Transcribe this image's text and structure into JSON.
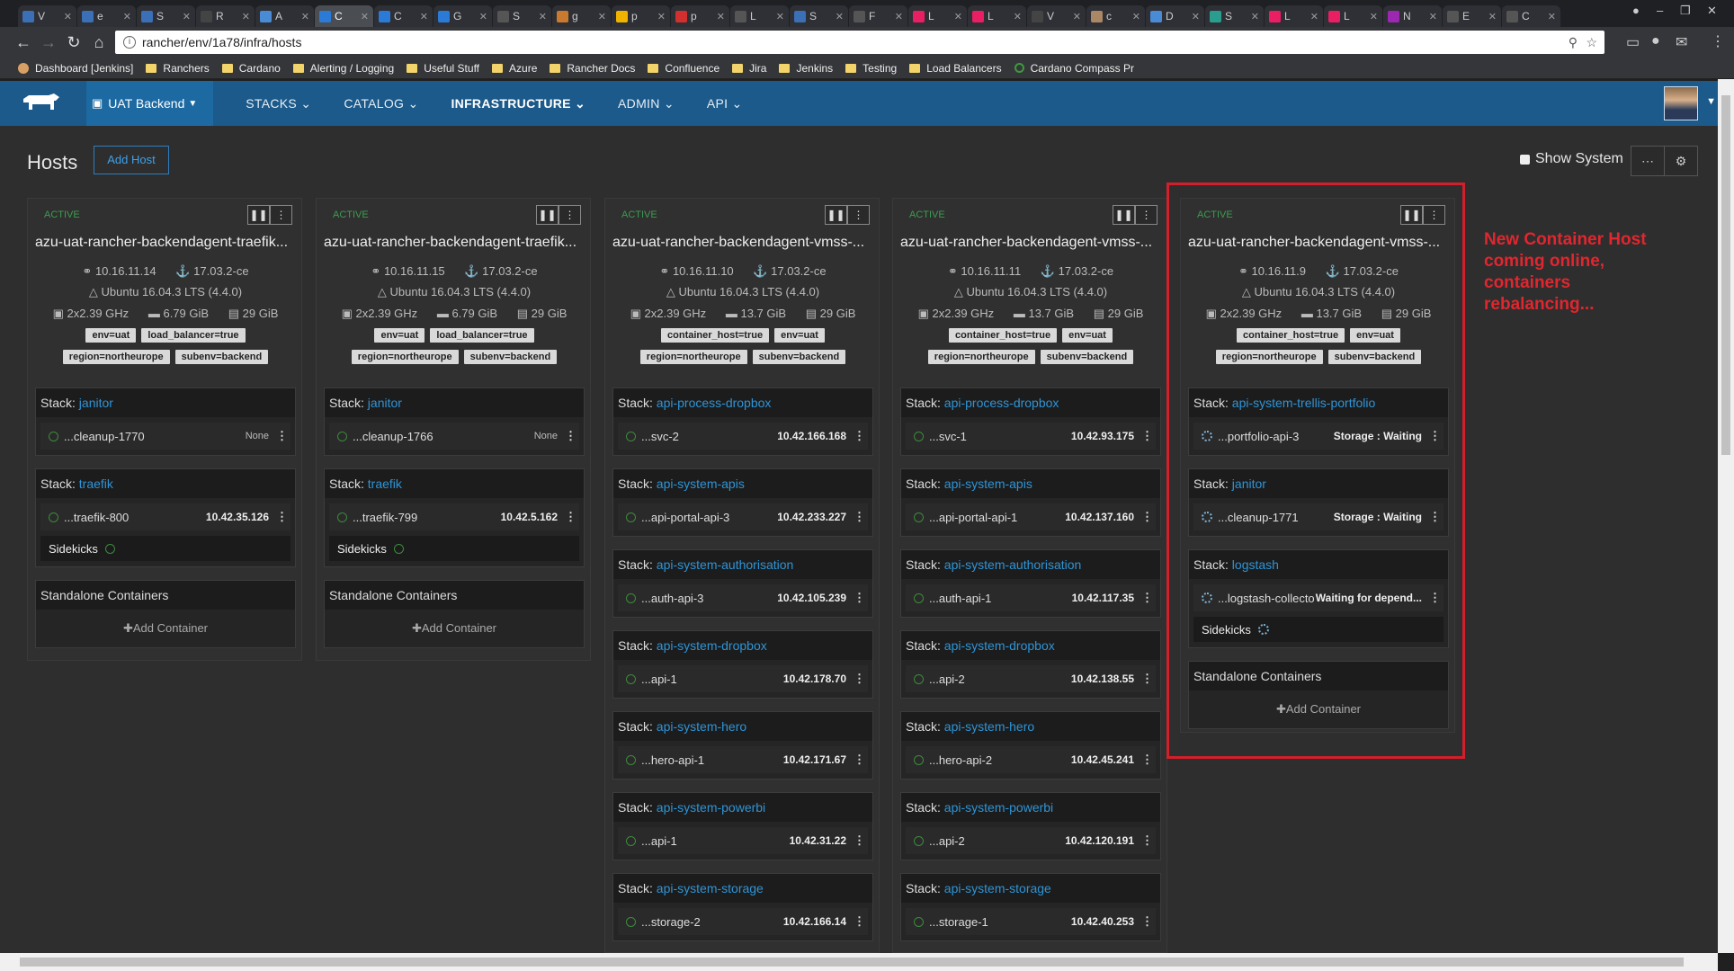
{
  "browser": {
    "tabs": [
      "V",
      "e",
      "S",
      "R",
      "A",
      "C",
      "C",
      "G",
      "S",
      "g",
      "p",
      "p",
      "L",
      "S",
      "F",
      "L",
      "L",
      "V",
      "c",
      "D",
      "S",
      "L",
      "L",
      "N",
      "E",
      "C"
    ],
    "url": "rancher/env/1a78/infra/hosts",
    "bookmarks": [
      "Dashboard [Jenkins]",
      "Ranchers",
      "Cardano",
      "Alerting / Logging",
      "Useful Stuff",
      "Azure",
      "Rancher Docs",
      "Confluence",
      "Jira",
      "Jenkins",
      "Testing",
      "Load Balancers",
      "Cardano Compass Pr"
    ]
  },
  "nav": {
    "env": "UAT Backend",
    "items": [
      "STACKS",
      "CATALOG",
      "INFRASTRUCTURE",
      "ADMIN",
      "API"
    ],
    "active": "INFRASTRUCTURE"
  },
  "page": {
    "title": "Hosts",
    "add_host": "Add Host",
    "show_system": "Show System"
  },
  "hosts": [
    {
      "state": "ACTIVE",
      "name": "azu-uat-rancher-backendagent-traefik...",
      "ip": "10.16.11.14",
      "docker": "17.03.2-ce",
      "os": "Ubuntu 16.04.3 LTS (4.4.0)",
      "cpu": "2x2.39 GHz",
      "mem": "6.79 GiB",
      "disk": "29 GiB",
      "tags1": [
        "env=uat",
        "load_balancer=true"
      ],
      "tags2": [
        "region=northeurope",
        "subenv=backend"
      ],
      "stacks": [
        {
          "label": "Stack:",
          "name": "janitor",
          "containers": [
            {
              "name": "...cleanup-1770",
              "value": "None"
            }
          ]
        },
        {
          "label": "Stack:",
          "name": "traefik",
          "containers": [
            {
              "name": "...traefik-800",
              "value": "10.42.35.126"
            }
          ],
          "sidekicks": "Sidekicks"
        }
      ],
      "standalone": "Standalone Containers",
      "add_container": "Add Container"
    },
    {
      "state": "ACTIVE",
      "name": "azu-uat-rancher-backendagent-traefik...",
      "ip": "10.16.11.15",
      "docker": "17.03.2-ce",
      "os": "Ubuntu 16.04.3 LTS (4.4.0)",
      "cpu": "2x2.39 GHz",
      "mem": "6.79 GiB",
      "disk": "29 GiB",
      "tags1": [
        "env=uat",
        "load_balancer=true"
      ],
      "tags2": [
        "region=northeurope",
        "subenv=backend"
      ],
      "stacks": [
        {
          "label": "Stack:",
          "name": "janitor",
          "containers": [
            {
              "name": "...cleanup-1766",
              "value": "None"
            }
          ]
        },
        {
          "label": "Stack:",
          "name": "traefik",
          "containers": [
            {
              "name": "...traefik-799",
              "value": "10.42.5.162"
            }
          ],
          "sidekicks": "Sidekicks"
        }
      ],
      "standalone": "Standalone Containers",
      "add_container": "Add Container"
    },
    {
      "state": "ACTIVE",
      "name": "azu-uat-rancher-backendagent-vmss-...",
      "ip": "10.16.11.10",
      "docker": "17.03.2-ce",
      "os": "Ubuntu 16.04.3 LTS (4.4.0)",
      "cpu": "2x2.39 GHz",
      "mem": "13.7 GiB",
      "disk": "29 GiB",
      "tags1": [
        "container_host=true",
        "env=uat"
      ],
      "tags2": [
        "region=northeurope",
        "subenv=backend"
      ],
      "stacks": [
        {
          "label": "Stack:",
          "name": "api-process-dropbox",
          "containers": [
            {
              "name": "...svc-2",
              "value": "10.42.166.168"
            }
          ]
        },
        {
          "label": "Stack:",
          "name": "api-system-apis",
          "containers": [
            {
              "name": "...api-portal-api-3",
              "value": "10.42.233.227"
            }
          ]
        },
        {
          "label": "Stack:",
          "name": "api-system-authorisation",
          "containers": [
            {
              "name": "...auth-api-3",
              "value": "10.42.105.239"
            }
          ]
        },
        {
          "label": "Stack:",
          "name": "api-system-dropbox",
          "containers": [
            {
              "name": "...api-1",
              "value": "10.42.178.70"
            }
          ]
        },
        {
          "label": "Stack:",
          "name": "api-system-hero",
          "containers": [
            {
              "name": "...hero-api-1",
              "value": "10.42.171.67"
            }
          ]
        },
        {
          "label": "Stack:",
          "name": "api-system-powerbi",
          "containers": [
            {
              "name": "...api-1",
              "value": "10.42.31.22"
            }
          ]
        },
        {
          "label": "Stack:",
          "name": "api-system-storage",
          "containers": [
            {
              "name": "...storage-2",
              "value": "10.42.166.14"
            }
          ]
        }
      ]
    },
    {
      "state": "ACTIVE",
      "name": "azu-uat-rancher-backendagent-vmss-...",
      "ip": "10.16.11.11",
      "docker": "17.03.2-ce",
      "os": "Ubuntu 16.04.3 LTS (4.4.0)",
      "cpu": "2x2.39 GHz",
      "mem": "13.7 GiB",
      "disk": "29 GiB",
      "tags1": [
        "container_host=true",
        "env=uat"
      ],
      "tags2": [
        "region=northeurope",
        "subenv=backend"
      ],
      "stacks": [
        {
          "label": "Stack:",
          "name": "api-process-dropbox",
          "containers": [
            {
              "name": "...svc-1",
              "value": "10.42.93.175"
            }
          ]
        },
        {
          "label": "Stack:",
          "name": "api-system-apis",
          "containers": [
            {
              "name": "...api-portal-api-1",
              "value": "10.42.137.160"
            }
          ]
        },
        {
          "label": "Stack:",
          "name": "api-system-authorisation",
          "containers": [
            {
              "name": "...auth-api-1",
              "value": "10.42.117.35"
            }
          ]
        },
        {
          "label": "Stack:",
          "name": "api-system-dropbox",
          "containers": [
            {
              "name": "...api-2",
              "value": "10.42.138.55"
            }
          ]
        },
        {
          "label": "Stack:",
          "name": "api-system-hero",
          "containers": [
            {
              "name": "...hero-api-2",
              "value": "10.42.45.241"
            }
          ]
        },
        {
          "label": "Stack:",
          "name": "api-system-powerbi",
          "containers": [
            {
              "name": "...api-2",
              "value": "10.42.120.191"
            }
          ]
        },
        {
          "label": "Stack:",
          "name": "api-system-storage",
          "containers": [
            {
              "name": "...storage-1",
              "value": "10.42.40.253"
            }
          ]
        }
      ]
    },
    {
      "state": "ACTIVE",
      "name": "azu-uat-rancher-backendagent-vmss-...",
      "ip": "10.16.11.9",
      "docker": "17.03.2-ce",
      "os": "Ubuntu 16.04.3 LTS (4.4.0)",
      "cpu": "2x2.39 GHz",
      "mem": "13.7 GiB",
      "disk": "29 GiB",
      "tags1": [
        "container_host=true",
        "env=uat"
      ],
      "tags2": [
        "region=northeurope",
        "subenv=backend"
      ],
      "stacks": [
        {
          "label": "Stack:",
          "name": "api-system-trellis-portfolio",
          "containers": [
            {
              "name": "...portfolio-api-3",
              "value": "Storage : Waiting",
              "pending": true
            }
          ]
        },
        {
          "label": "Stack:",
          "name": "janitor",
          "containers": [
            {
              "name": "...cleanup-1771",
              "value": "Storage : Waiting",
              "pending": true
            }
          ]
        },
        {
          "label": "Stack:",
          "name": "logstash",
          "containers": [
            {
              "name": "...logstash-collecto",
              "value": "Waiting for depend...",
              "pending": true
            }
          ],
          "sidekicks": "Sidekicks",
          "sidekicks_pending": true
        }
      ],
      "standalone": "Standalone Containers",
      "add_container": "Add Container"
    }
  ],
  "annotation": "New Container Host coming online, containers rebalancing...",
  "colors": {
    "nav": "#1b5a8a",
    "link": "#2e94d6",
    "active_state": "#3d9c4e",
    "highlight": "#d21f2a"
  }
}
